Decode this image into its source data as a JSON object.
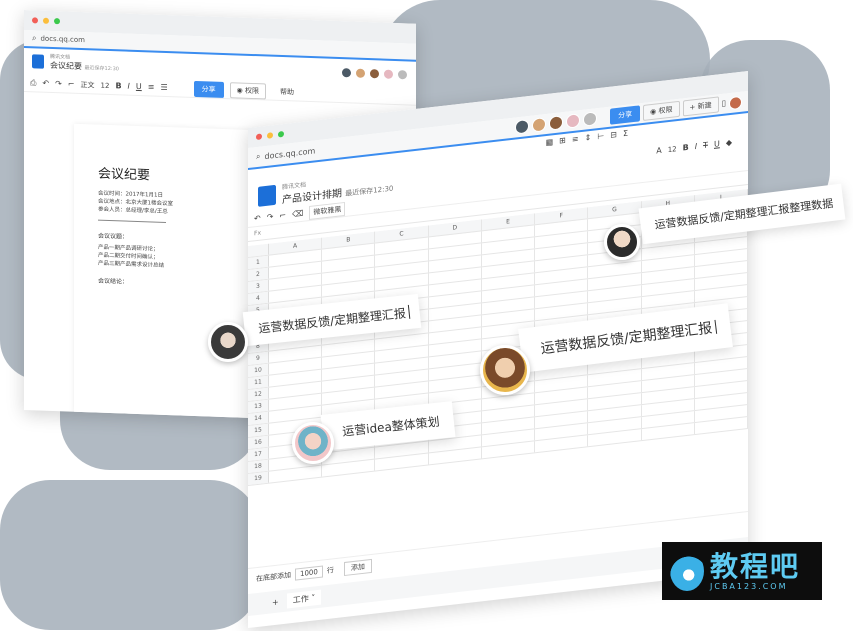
{
  "back_window": {
    "url": "docs.qq.com",
    "brand": "腾讯文档",
    "doc_title": "会议纪要",
    "saved_hint": "最近保存12:30",
    "share_label": "分享",
    "permission_label": "权限",
    "help_label": "帮助",
    "font_size": "12",
    "style_label": "正文",
    "doc_heading": "会议纪要",
    "meta_lines": [
      "会议时间：2017年1月1日",
      "会议地点：北京大厦1楼会议室",
      "参会人员：总经理/李总/王总"
    ],
    "section1": "会议议题：",
    "items": [
      "产品一期产品调研讨论；",
      "产品二期交付时间确认；",
      "产品三期产品需求设计总结"
    ],
    "section2": "会议结论："
  },
  "front_window": {
    "url": "docs.qq.com",
    "brand": "腾讯文档",
    "doc_title": "产品设计排期",
    "saved_hint": "最近保存12:30",
    "share_label": "分享",
    "permission_label": "权限",
    "new_label": "+ 新建",
    "font_name": "微软雅黑",
    "font_size": "12",
    "fx_label": "Fx",
    "columns": [
      "A",
      "B",
      "C",
      "D",
      "E",
      "F",
      "G",
      "H",
      "I"
    ],
    "rows": [
      "1",
      "2",
      "3",
      "4",
      "5",
      "6",
      "7",
      "8",
      "9",
      "10",
      "11",
      "12",
      "13",
      "14",
      "15",
      "16",
      "17",
      "18",
      "19"
    ],
    "add_rows_label": "在底部添加",
    "add_rows_count": "1000",
    "add_rows_unit": "行",
    "add_button": "添加",
    "add_sheet": "+",
    "sheet_tab": "工作"
  },
  "bubbles": {
    "b1": "运营数据反馈/定期整理汇报整理数据",
    "b2": "运营数据反馈/定期整理汇报",
    "b3": "运营数据反馈/定期整理汇报",
    "b4": "运营idea整体策划"
  },
  "watermark": {
    "title": "教程吧",
    "subtitle": "JCBA123.COM"
  },
  "colors": {
    "accent": "#3b8df0",
    "background_blob": "#a9b3bd"
  }
}
